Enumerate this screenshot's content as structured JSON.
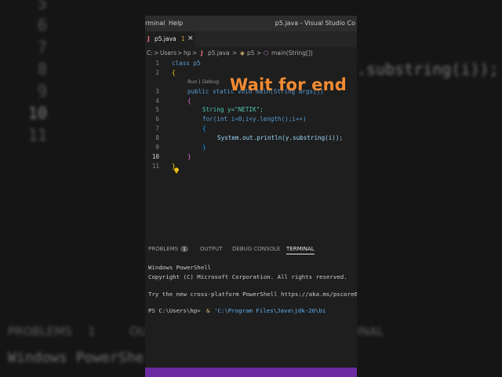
{
  "background": {
    "line_numbers": [
      "5",
      "6",
      "7",
      "8",
      "9",
      "10",
      "11"
    ],
    "code_fragment": ".substring(i));",
    "tabs": [
      "PROBLEMS",
      "1",
      "OU",
      "INAL"
    ],
    "bottom_text": "Windows PowerShe"
  },
  "titlebar": {
    "menu_terminal": "rminal",
    "menu_help": "Help",
    "title": "p5.java - Visual Studio Co"
  },
  "tab": {
    "name": "p5.java",
    "count": "1",
    "close": "×",
    "lang_letter": "J"
  },
  "breadcrumb": [
    "C:",
    ">",
    "Users",
    ">",
    "hp",
    ">",
    "J",
    "p5.java",
    ">",
    "p5",
    ">",
    "main(String[])"
  ],
  "overlay": "Wait for end",
  "codelens": "Run | Debug",
  "lines": [
    {
      "n": "1",
      "text": "class p5"
    },
    {
      "n": "2",
      "text": "{"
    },
    {
      "n": "3",
      "text": "public static void main(String args[])"
    },
    {
      "n": "4",
      "text": "{"
    },
    {
      "n": "5",
      "text": "String y=\"NETIK\";"
    },
    {
      "n": "6",
      "text": "for(int i=0;i<y.length();i++)"
    },
    {
      "n": "7",
      "text": "{"
    },
    {
      "n": "8",
      "text": "System.out.println(y.substring(i));"
    },
    {
      "n": "9",
      "text": "}"
    },
    {
      "n": "10",
      "text": "}"
    },
    {
      "n": "11",
      "text": "}"
    }
  ],
  "panel": {
    "problems": "PROBLEMS",
    "problems_count": "1",
    "output": "OUTPUT",
    "debug_console": "DEBUG CONSOLE",
    "terminal": "TERMINAL"
  },
  "terminal": {
    "line1": "Windows PowerShell",
    "line2": "Copyright (C) Microsoft Corporation. All rights reserved.",
    "line3": "Try the new cross-platform PowerShell https://aka.ms/pscore6",
    "prompt": "PS C:\\Users\\hp>",
    "cmd_amp": "&",
    "cmd_path": "'C:\\Program Files\\Java\\jdk-20\\bi"
  },
  "colors": {
    "accent": "#f28b33",
    "statusbar": "#6b2aa1"
  }
}
